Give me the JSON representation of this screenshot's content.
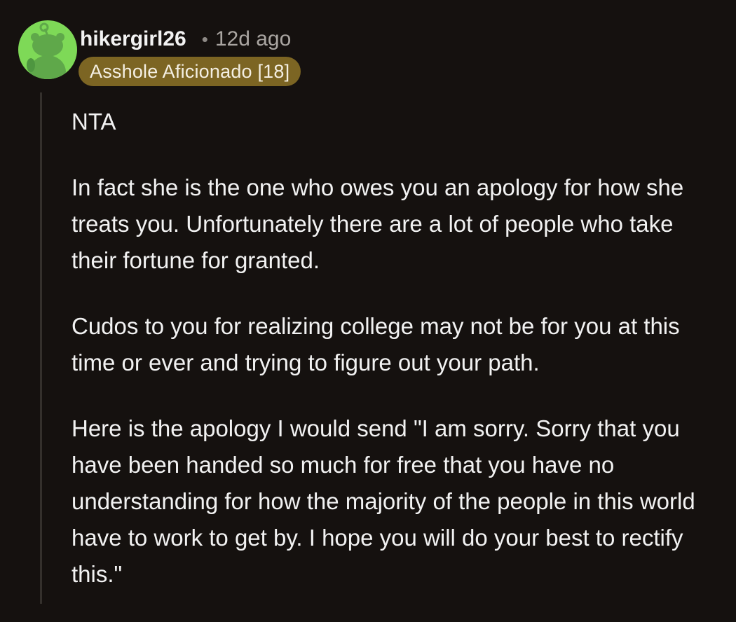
{
  "comment": {
    "username": "hikergirl26",
    "separator": "•",
    "timestamp": "12d ago",
    "flair": "Asshole Aficionado [18]",
    "paragraphs": [
      "NTA",
      "In fact she is the one who owes you an apology for how she treats you. Unfortunately there are a lot of people who take their fortune for granted.",
      "Cudos to you for realizing college may not be for you at this time or ever and trying to figure out your path.",
      "Here is the apology I would send \"I am sorry. Sorry that you have been handed so much for free that you have no understanding for how the majority of the people in this world have to work to get by. I hope you will do your best to rectify this.\""
    ]
  },
  "colors": {
    "background": "#15110f",
    "avatar_bg": "#7ed957",
    "avatar_figure": "#5fa84a",
    "flair_bg": "#7c6523",
    "text": "#f2f2f2",
    "muted": "#a9a5a1"
  },
  "icons": {
    "avatar": "snoo-avatar-icon"
  }
}
